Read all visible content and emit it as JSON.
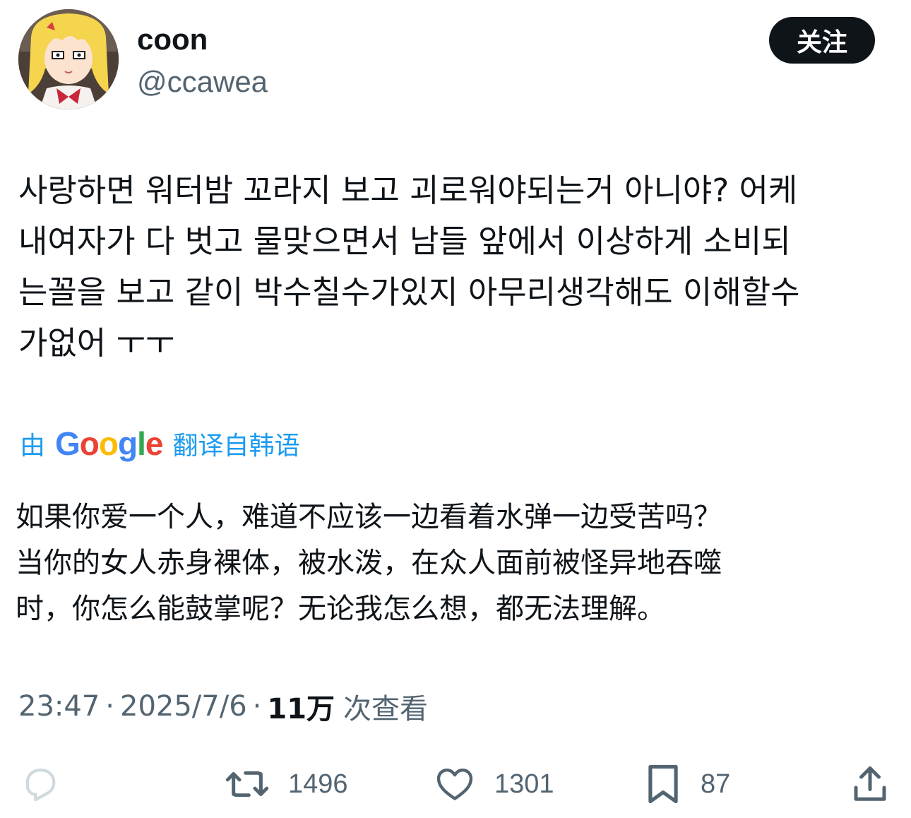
{
  "user": {
    "display_name": "coon",
    "handle": "@ccawea",
    "follow_label": "关注",
    "avatar_icon": "anime-avatar-icon"
  },
  "tweet": {
    "text": "사랑하면 워터밤 꼬라지 보고 괴로워야되는거 아니야? 어케\n내여자가 다 벗고 물맞으면서 남들 앞에서 이상하게 소비되\n는꼴을 보고 같이 박수칠수가있지 아무리생각해도 이해할수\n가없어 ㅜㅜ"
  },
  "translation": {
    "prefix": "由",
    "google_letters": [
      {
        "char": "G",
        "color": "#4285F4"
      },
      {
        "char": "o",
        "color": "#EA4335"
      },
      {
        "char": "o",
        "color": "#FBBC05"
      },
      {
        "char": "g",
        "color": "#4285F4"
      },
      {
        "char": "l",
        "color": "#34A853"
      },
      {
        "char": "e",
        "color": "#EA4335"
      }
    ],
    "suffix": "翻译自韩语",
    "text": "如果你爱一个人，难道不应该一边看着水弹一边受苦吗？\n当你的女人赤身裸体，被水泼，在众人面前被怪异地吞噬\n时，你怎么能鼓掌呢？无论我怎么想，都无法理解。"
  },
  "meta": {
    "time": "23:47",
    "separator": "·",
    "date": "2025/7/6",
    "views_count": "11万",
    "views_label": "次查看"
  },
  "actions": {
    "reply": {
      "icon": "reply-icon",
      "count": ""
    },
    "retweet": {
      "icon": "retweet-icon",
      "count": "1496"
    },
    "like": {
      "icon": "heart-icon",
      "count": "1301"
    },
    "bookmark": {
      "icon": "bookmark-icon",
      "count": "87"
    },
    "share": {
      "icon": "share-icon",
      "count": ""
    }
  },
  "colors": {
    "text": "#0f1419",
    "secondary": "#536471",
    "link": "#1d9bf0",
    "button_bg": "#0f1419"
  }
}
